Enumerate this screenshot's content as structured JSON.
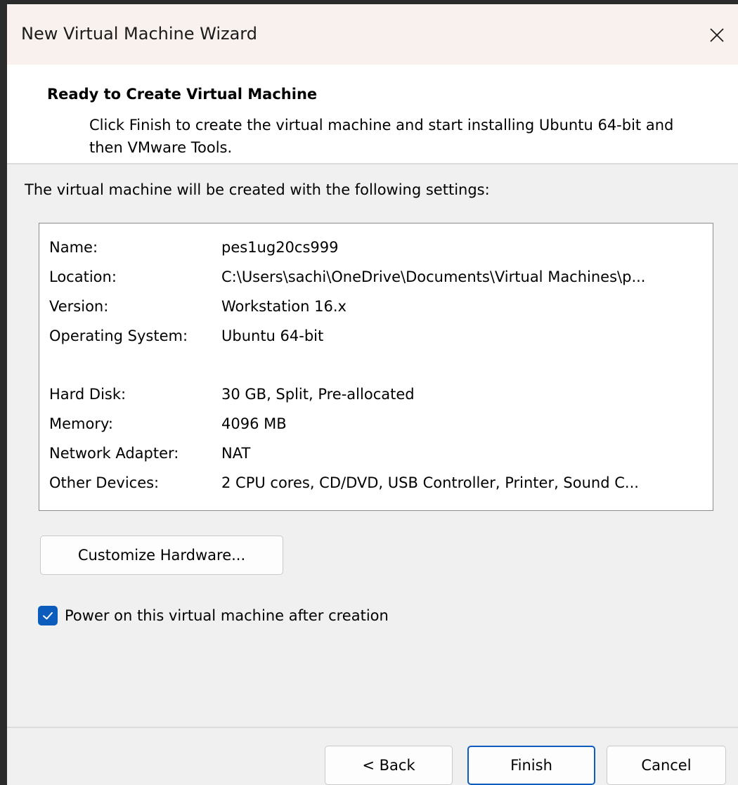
{
  "window": {
    "title": "New Virtual Machine Wizard"
  },
  "header": {
    "title": "Ready to Create Virtual Machine",
    "description": "Click Finish to create the virtual machine and start installing Ubuntu 64-bit and then VMware Tools."
  },
  "intro": "The virtual machine will be created with the following settings:",
  "settings": [
    {
      "label": "Name:",
      "value": "pes1ug20cs999"
    },
    {
      "label": "Location:",
      "value": "C:\\Users\\sachi\\OneDrive\\Documents\\Virtual Machines\\p..."
    },
    {
      "label": "Version:",
      "value": "Workstation 16.x"
    },
    {
      "label": "Operating System:",
      "value": "Ubuntu 64-bit"
    },
    {
      "label": "Hard Disk:",
      "value": "30 GB, Split, Pre-allocated"
    },
    {
      "label": "Memory:",
      "value": "4096 MB"
    },
    {
      "label": "Network Adapter:",
      "value": "NAT"
    },
    {
      "label": "Other Devices:",
      "value": "2 CPU cores, CD/DVD, USB Controller, Printer, Sound C..."
    }
  ],
  "buttons": {
    "customize": "Customize Hardware...",
    "back": "< Back",
    "finish": "Finish",
    "cancel": "Cancel"
  },
  "power_on": {
    "label": "Power on this virtual machine after creation",
    "checked": true
  },
  "colors": {
    "accent": "#0b5cbd",
    "titlebar": "#f9f1ee"
  }
}
